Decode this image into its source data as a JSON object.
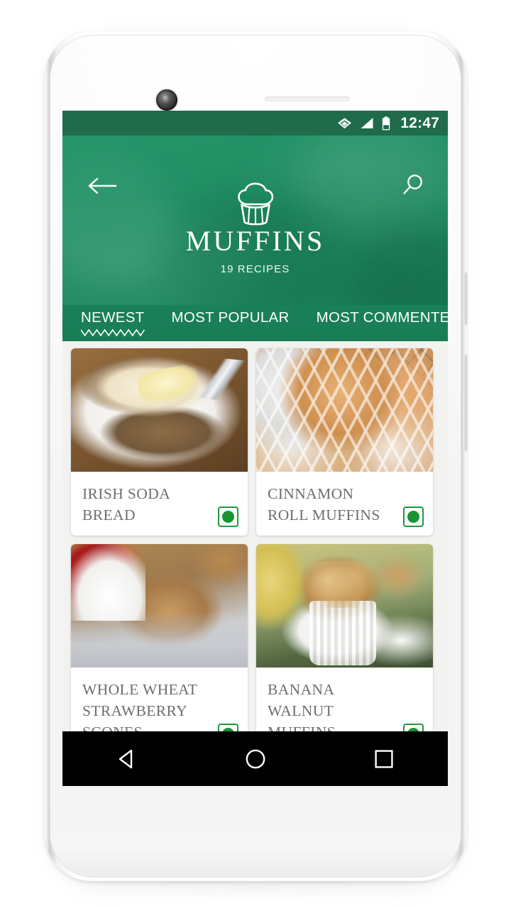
{
  "device": {
    "type": "android-phone-mockup",
    "frame_color": "#ffffff"
  },
  "status_bar": {
    "time": "12:47",
    "icons": [
      "wifi-icon",
      "cellular-signal-icon",
      "battery-icon"
    ],
    "background": "#1f6b4a"
  },
  "header": {
    "back_label": "back-arrow",
    "search_label": "search",
    "logo": "muffin-icon",
    "title": "MUFFINS",
    "subtitle": "19 RECIPES",
    "accent_color": "#1f8d62"
  },
  "tabs": {
    "items": [
      {
        "label": "NEWEST",
        "active": true
      },
      {
        "label": "MOST POPULAR",
        "active": false
      },
      {
        "label": "MOST COMMENTED",
        "active": false
      }
    ],
    "indicator": "zigzag-underline"
  },
  "recipes": [
    {
      "title": "IRISH SODA BREAD",
      "badge": "vegetarian",
      "photo": "ph-soda"
    },
    {
      "title": "CINNAMON ROLL MUFFINS",
      "badge": "vegetarian",
      "photo": "ph-cinn"
    },
    {
      "title": "WHOLE WHEAT STRAWBERRY SCONES",
      "badge": "vegetarian",
      "photo": "ph-scone"
    },
    {
      "title": "BANANA WALNUT MUFFINS",
      "badge": "vegetarian",
      "photo": "ph-banana"
    }
  ],
  "partial_recipes": [
    {
      "photo": "ph-p1"
    },
    {
      "photo": "ph-p2"
    }
  ],
  "nav_bar": {
    "buttons": [
      "back-triangle-icon",
      "home-circle-icon",
      "recents-square-icon"
    ],
    "background": "#000000"
  },
  "colors": {
    "brand_green": "#1f8d62",
    "status_green": "#1f6b4a",
    "badge_green": "#1a9431",
    "card_title_gray": "#6e6e6e",
    "screen_background": "#f2f2f0"
  }
}
